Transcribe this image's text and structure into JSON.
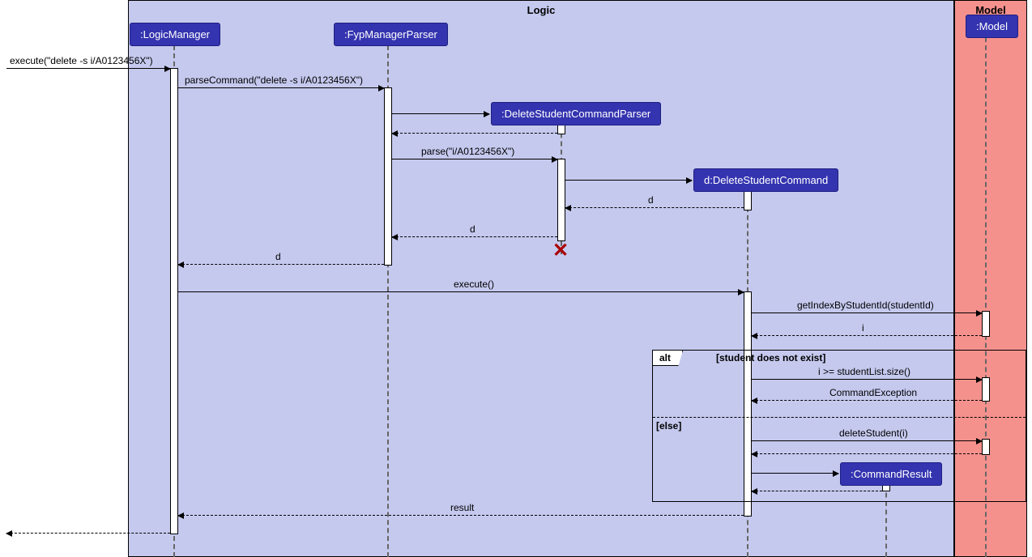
{
  "frames": {
    "logic": "Logic",
    "model": "Model"
  },
  "participants": {
    "logicManager": ":LogicManager",
    "fypParser": ":FypManagerParser",
    "deleteParser": ":DeleteStudentCommandParser",
    "deleteCmd": "d:DeleteStudentCommand",
    "cmdResult": ":CommandResult",
    "modelP": ":Model"
  },
  "messages": {
    "m1": "execute(\"delete -s i/A0123456X\")",
    "m2": "parseCommand(\"delete -s i/A0123456X\")",
    "m3": "parse(\"i/A0123456X\")",
    "ret_d": "d",
    "m4": "execute()",
    "m5": "getIndexByStudentId(studentId)",
    "ret_i": "i",
    "m6": "i >= studentList.size()",
    "ret_ce": "CommandException",
    "m7": "deleteStudent(i)",
    "ret_result": "result"
  },
  "alt": {
    "label": "alt",
    "guard1": "[student does not exist]",
    "guard2": "[else]"
  }
}
